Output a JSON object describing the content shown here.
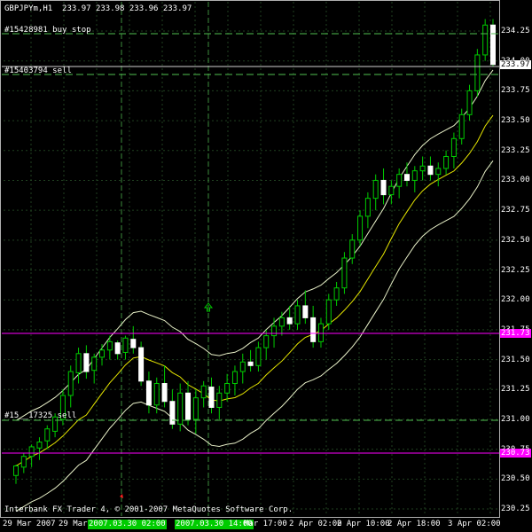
{
  "header": {
    "symbol": "GBPJPYm,H1",
    "ohlc": "233.97 233.98 233.96 233.97"
  },
  "orders": [
    {
      "text": "#15428981 buy stop",
      "price": 234.12
    },
    {
      "text": "#15403794 sell",
      "price": 233.88
    },
    {
      "text": "#15__17325 sell",
      "price": 231.0
    }
  ],
  "price_axis": {
    "ticks": [
      "234.25",
      "234.00",
      "233.75",
      "233.50",
      "233.25",
      "233.00",
      "232.75",
      "232.50",
      "232.25",
      "232.00",
      "231.75",
      "231.50",
      "231.25",
      "231.00",
      "230.75",
      "230.50",
      "230.25"
    ],
    "current_price": "233.97",
    "level_high": "231.73",
    "level_low": "230.73"
  },
  "time_axis": {
    "labels": [
      "29 Mar 2007",
      "29 Mar",
      "2 Apr 02:00",
      "2 Apr 10:00",
      "2 Apr 18:00",
      "3 Apr 02:00"
    ],
    "period_tags": [
      "2007.03.30 02:00",
      "2007.03.30 14:00"
    ],
    "partial_label": "Mar 17:00"
  },
  "footer": {
    "copyright": "Interbank FX Trader 4, © 2001-2007 MetaQuotes Software Corp."
  },
  "colors": {
    "background": "#000000",
    "grid": "#1f3f1f",
    "bull": "#ffffff",
    "bear": "#ffffff",
    "wick": "#00cc00",
    "ma_yellow": "#e6e600",
    "envelope": "#e8f0c8",
    "order_line": "#4fbf4f",
    "magenta": "#ff00ff",
    "tag_green": "#00c000"
  },
  "chart_data": {
    "type": "candlestick",
    "y_range": [
      230.25,
      234.35
    ],
    "candles": [
      [
        230.53,
        230.62,
        230.46,
        230.61
      ],
      [
        230.6,
        230.72,
        230.55,
        230.69
      ],
      [
        230.69,
        230.79,
        230.6,
        230.77
      ],
      [
        230.76,
        230.85,
        230.66,
        230.81
      ],
      [
        230.82,
        230.95,
        230.75,
        230.92
      ],
      [
        230.9,
        231.05,
        230.85,
        231.02
      ],
      [
        231.0,
        231.25,
        230.95,
        231.2
      ],
      [
        231.2,
        231.45,
        231.1,
        231.4
      ],
      [
        231.39,
        231.6,
        231.3,
        231.55
      ],
      [
        231.55,
        231.62,
        231.34,
        231.4
      ],
      [
        231.41,
        231.55,
        231.3,
        231.52
      ],
      [
        231.52,
        231.63,
        231.45,
        231.58
      ],
      [
        231.58,
        231.7,
        231.5,
        231.65
      ],
      [
        231.64,
        231.66,
        231.5,
        231.55
      ],
      [
        231.56,
        231.7,
        231.5,
        231.68
      ],
      [
        231.67,
        231.78,
        231.55,
        231.6
      ],
      [
        231.6,
        231.65,
        231.28,
        231.32
      ],
      [
        231.32,
        231.4,
        231.05,
        231.12
      ],
      [
        231.12,
        231.35,
        231.05,
        231.3
      ],
      [
        231.3,
        231.45,
        231.1,
        231.15
      ],
      [
        231.15,
        231.25,
        230.92,
        230.96
      ],
      [
        230.96,
        231.3,
        230.9,
        231.22
      ],
      [
        231.22,
        231.32,
        230.95,
        231.0
      ],
      [
        231.0,
        231.25,
        230.88,
        231.18
      ],
      [
        231.18,
        231.32,
        231.1,
        231.28
      ],
      [
        231.27,
        231.35,
        231.05,
        231.1
      ],
      [
        231.1,
        231.28,
        231.0,
        231.22
      ],
      [
        231.22,
        231.38,
        231.15,
        231.3
      ],
      [
        231.3,
        231.45,
        231.2,
        231.4
      ],
      [
        231.4,
        231.55,
        231.3,
        231.48
      ],
      [
        231.48,
        231.58,
        231.4,
        231.45
      ],
      [
        231.45,
        231.65,
        231.4,
        231.6
      ],
      [
        231.6,
        231.75,
        231.5,
        231.7
      ],
      [
        231.7,
        231.85,
        231.6,
        231.78
      ],
      [
        231.78,
        231.9,
        231.7,
        231.85
      ],
      [
        231.85,
        231.95,
        231.75,
        231.8
      ],
      [
        231.8,
        232.0,
        231.75,
        231.95
      ],
      [
        231.95,
        232.08,
        231.8,
        231.85
      ],
      [
        231.85,
        231.95,
        231.6,
        231.65
      ],
      [
        231.65,
        231.85,
        231.6,
        231.8
      ],
      [
        231.8,
        232.05,
        231.75,
        232.0
      ],
      [
        232.0,
        232.15,
        231.95,
        232.1
      ],
      [
        232.1,
        232.4,
        232.05,
        232.35
      ],
      [
        232.35,
        232.55,
        232.3,
        232.5
      ],
      [
        232.5,
        232.75,
        232.45,
        232.7
      ],
      [
        232.7,
        232.9,
        232.6,
        232.85
      ],
      [
        232.85,
        233.05,
        232.75,
        233.0
      ],
      [
        233.0,
        233.1,
        232.8,
        232.88
      ],
      [
        232.88,
        233.0,
        232.8,
        232.95
      ],
      [
        232.95,
        233.1,
        232.85,
        233.05
      ],
      [
        233.05,
        233.15,
        232.95,
        233.0
      ],
      [
        233.0,
        233.12,
        232.9,
        233.08
      ],
      [
        233.08,
        233.2,
        233.0,
        233.12
      ],
      [
        233.12,
        233.2,
        233.0,
        233.05
      ],
      [
        233.05,
        233.15,
        232.95,
        233.1
      ],
      [
        233.1,
        233.25,
        233.05,
        233.2
      ],
      [
        233.2,
        233.4,
        233.1,
        233.35
      ],
      [
        233.35,
        233.6,
        233.3,
        233.55
      ],
      [
        233.55,
        233.8,
        233.5,
        233.75
      ],
      [
        233.75,
        234.1,
        233.7,
        234.05
      ],
      [
        234.05,
        234.35,
        234.0,
        234.3
      ],
      [
        234.3,
        234.35,
        233.95,
        233.97
      ]
    ]
  }
}
